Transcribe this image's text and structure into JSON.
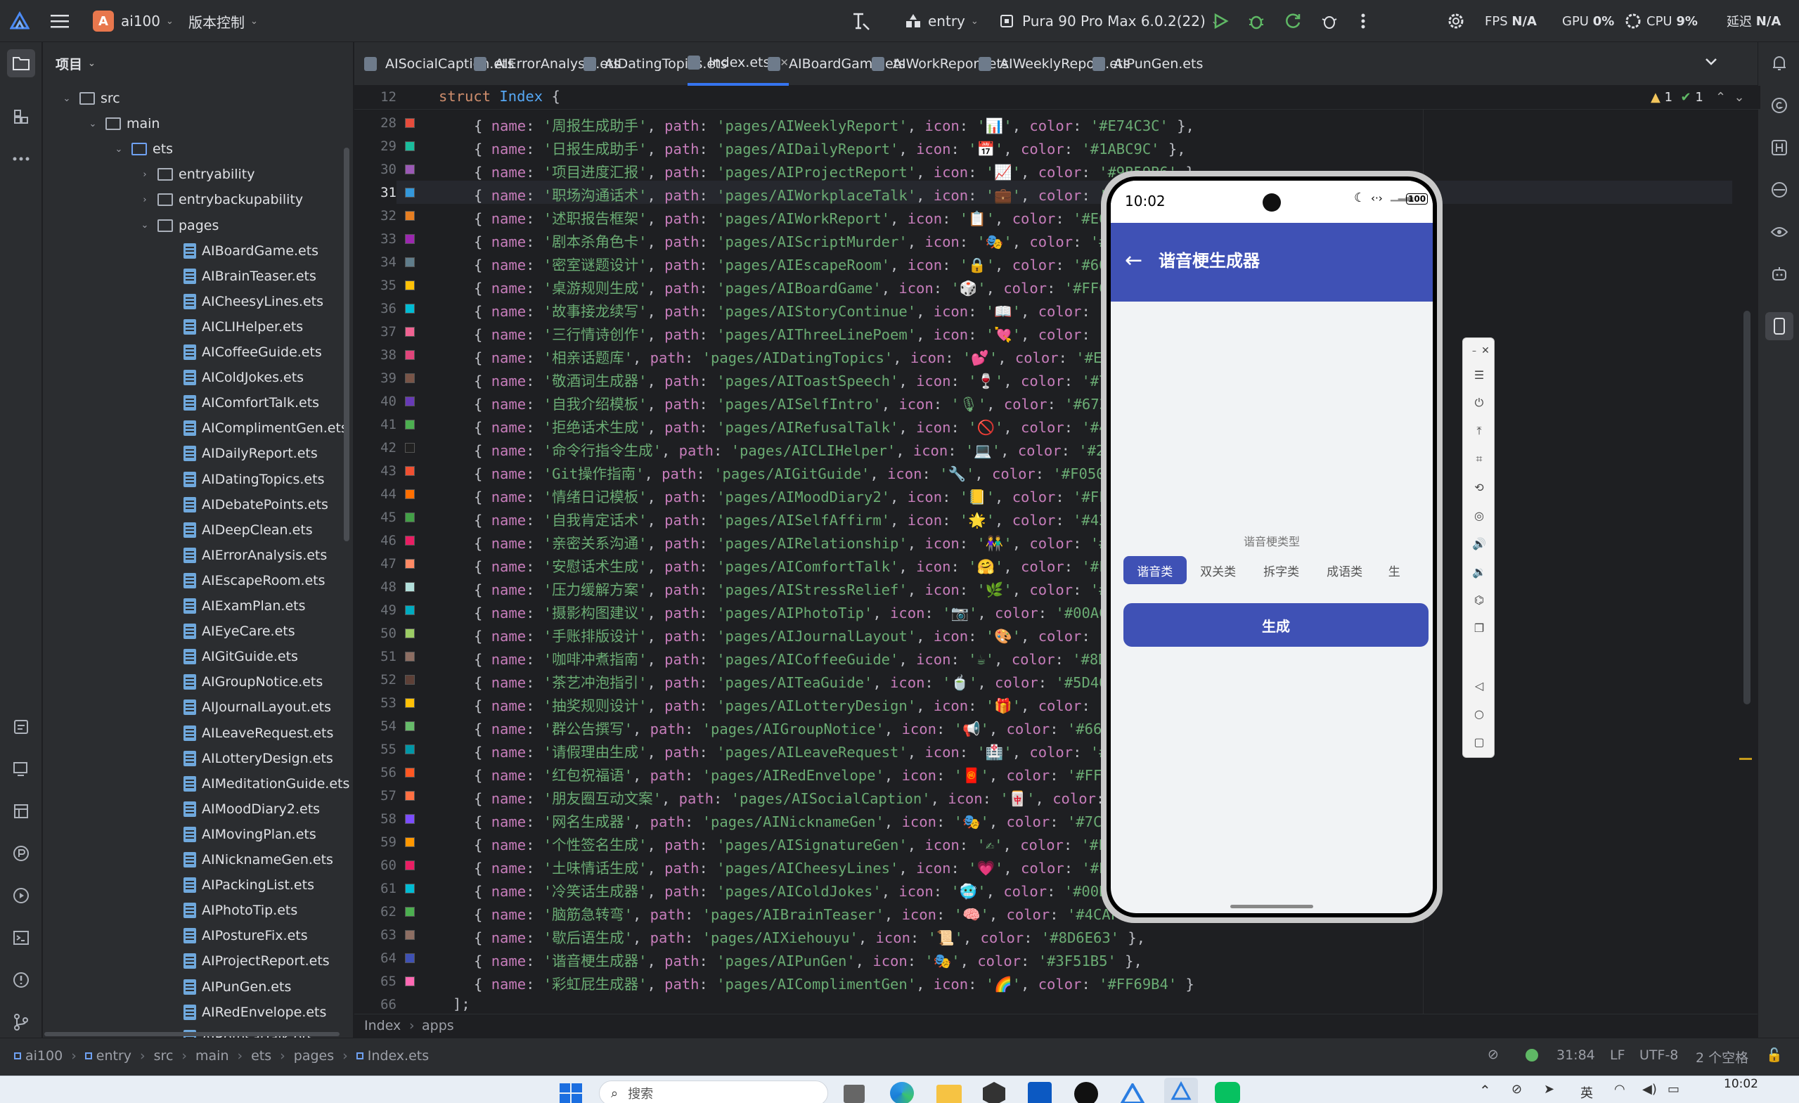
{
  "titlebar": {
    "project_badge": "A",
    "project_name": "ai100",
    "vcs_label": "版本控制",
    "run_config": "entry",
    "device": "Pura 90 Pro Max 6.0.2(22)",
    "metrics": {
      "fps_label": "FPS",
      "fps_value": "N/A",
      "gpu_label": "GPU",
      "gpu_value": "0%",
      "cpu_label": "CPU",
      "cpu_value": "9%",
      "latency_label": "延迟",
      "latency_value": "N/A"
    }
  },
  "project_panel": {
    "title": "项目",
    "tree": [
      {
        "label": "src",
        "type": "folder",
        "depth": 0,
        "expanded": true
      },
      {
        "label": "main",
        "type": "folder",
        "depth": 1,
        "expanded": true
      },
      {
        "label": "ets",
        "type": "folder-blue",
        "depth": 2,
        "expanded": true
      },
      {
        "label": "entryability",
        "type": "folder",
        "depth": 3,
        "expanded": false
      },
      {
        "label": "entrybackupability",
        "type": "folder",
        "depth": 3,
        "expanded": false
      },
      {
        "label": "pages",
        "type": "folder",
        "depth": 3,
        "expanded": true
      },
      {
        "label": "AIBoardGame.ets",
        "type": "file",
        "depth": 4
      },
      {
        "label": "AIBrainTeaser.ets",
        "type": "file",
        "depth": 4
      },
      {
        "label": "AICheesyLines.ets",
        "type": "file",
        "depth": 4
      },
      {
        "label": "AICLIHelper.ets",
        "type": "file",
        "depth": 4
      },
      {
        "label": "AICoffeeGuide.ets",
        "type": "file",
        "depth": 4
      },
      {
        "label": "AIColdJokes.ets",
        "type": "file",
        "depth": 4
      },
      {
        "label": "AIComfortTalk.ets",
        "type": "file",
        "depth": 4
      },
      {
        "label": "AIComplimentGen.ets",
        "type": "file",
        "depth": 4
      },
      {
        "label": "AIDailyReport.ets",
        "type": "file",
        "depth": 4
      },
      {
        "label": "AIDatingTopics.ets",
        "type": "file",
        "depth": 4
      },
      {
        "label": "AIDebatePoints.ets",
        "type": "file",
        "depth": 4
      },
      {
        "label": "AIDeepClean.ets",
        "type": "file",
        "depth": 4
      },
      {
        "label": "AIErrorAnalysis.ets",
        "type": "file",
        "depth": 4
      },
      {
        "label": "AIEscapeRoom.ets",
        "type": "file",
        "depth": 4
      },
      {
        "label": "AIExamPlan.ets",
        "type": "file",
        "depth": 4
      },
      {
        "label": "AIEyeCare.ets",
        "type": "file",
        "depth": 4
      },
      {
        "label": "AIGitGuide.ets",
        "type": "file",
        "depth": 4
      },
      {
        "label": "AIGroupNotice.ets",
        "type": "file",
        "depth": 4
      },
      {
        "label": "AIJournalLayout.ets",
        "type": "file",
        "depth": 4
      },
      {
        "label": "AILeaveRequest.ets",
        "type": "file",
        "depth": 4
      },
      {
        "label": "AILotteryDesign.ets",
        "type": "file",
        "depth": 4
      },
      {
        "label": "AIMeditationGuide.ets",
        "type": "file",
        "depth": 4
      },
      {
        "label": "AIMoodDiary2.ets",
        "type": "file",
        "depth": 4
      },
      {
        "label": "AIMovingPlan.ets",
        "type": "file",
        "depth": 4
      },
      {
        "label": "AINicknameGen.ets",
        "type": "file",
        "depth": 4
      },
      {
        "label": "AIPackingList.ets",
        "type": "file",
        "depth": 4
      },
      {
        "label": "AIPhotoTip.ets",
        "type": "file",
        "depth": 4
      },
      {
        "label": "AIPostureFix.ets",
        "type": "file",
        "depth": 4
      },
      {
        "label": "AIProjectReport.ets",
        "type": "file",
        "depth": 4
      },
      {
        "label": "AIPunGen.ets",
        "type": "file",
        "depth": 4
      },
      {
        "label": "AIRedEnvelope.ets",
        "type": "file",
        "depth": 4
      },
      {
        "label": "AIRefusalTalk.ets",
        "type": "file",
        "depth": 4
      }
    ]
  },
  "tabs": [
    {
      "label": "AISocialCaption.ets",
      "active": false
    },
    {
      "label": "AIErrorAnalysis.ets",
      "active": false
    },
    {
      "label": "AIDatingTopics.ets",
      "active": false
    },
    {
      "label": "Index.ets",
      "active": true
    },
    {
      "label": "AIBoardGame.ets",
      "active": false
    },
    {
      "label": "AIWorkReport.ets",
      "active": false
    },
    {
      "label": "AIWeeklyReport.ets",
      "active": false
    },
    {
      "label": "AIPunGen.ets",
      "active": false
    }
  ],
  "editor": {
    "sticky_line": {
      "num": "12",
      "text": "struct Index {"
    },
    "inspections": {
      "warnings": "1",
      "ok": "1"
    },
    "current_line": "31",
    "lines": [
      {
        "num": "28",
        "name": "周报生成助手",
        "path": "pages/AIWeeklyReport",
        "icon": "📊",
        "color": "#E74C3C",
        "tail": " },",
        "sw": "#E74C3C"
      },
      {
        "num": "29",
        "name": "日报生成助手",
        "path": "pages/AIDailyReport",
        "icon": "📅",
        "color": "#1ABC9C",
        "tail": " },",
        "sw": "#1ABC9C"
      },
      {
        "num": "30",
        "name": "项目进度汇报",
        "path": "pages/AIProjectReport",
        "icon": "📈",
        "color": "#9B59B6",
        "tail": " },",
        "sw": "#9B59B6"
      },
      {
        "num": "31",
        "name": "职场沟通话术",
        "path": "pages/AIWorkplaceTalk",
        "icon": "💼",
        "color": "#3498DB",
        "tail": " },",
        "sw": "#3498DB"
      },
      {
        "num": "32",
        "name": "述职报告框架",
        "path": "pages/AIWorkReport",
        "icon": "📋",
        "color": "#E67E22",
        "tail": " },",
        "sw": "#E67E22"
      },
      {
        "num": "33",
        "name": "剧本杀角色卡",
        "path": "pages/AIScriptMurder",
        "icon": "🎭",
        "color": "#9C27B0",
        "tail": " },",
        "sw": "#9C27B0"
      },
      {
        "num": "34",
        "name": "密室谜题设计",
        "path": "pages/AIEscapeRoom",
        "icon": "🔒",
        "color": "#607D8B",
        "tail": " },",
        "sw": "#607D8B"
      },
      {
        "num": "35",
        "name": "桌游规则生成",
        "path": "pages/AIBoardGame",
        "icon": "🎲",
        "color": "#FFC107",
        "tail": " },",
        "sw": "#FFC107"
      },
      {
        "num": "36",
        "name": "故事接龙续写",
        "path": "pages/AIStoryContinue",
        "icon": "📖",
        "color": "#00BCD4",
        "tail": " },",
        "sw": "#00BCD4"
      },
      {
        "num": "37",
        "name": "三行情诗创作",
        "path": "pages/AIThreeLinePoem",
        "icon": "💘",
        "color": "#F06292",
        "tail": " },",
        "sw": "#F06292"
      },
      {
        "num": "38",
        "name": "相亲话题库",
        "path": "pages/AIDatingTopics",
        "icon": "💕",
        "color": "#E0457B",
        "tail": " },",
        "sw": "#E0457B"
      },
      {
        "num": "39",
        "name": "敬酒词生成器",
        "path": "pages/AIToastSpeech",
        "icon": "🍷",
        "color": "#795548",
        "tail": " },",
        "sw": "#795548"
      },
      {
        "num": "40",
        "name": "自我介绍模板",
        "path": "pages/AISelfIntro",
        "icon": "🎙",
        "color": "#673AB7",
        "tail": " },",
        "sw": "#673AB7"
      },
      {
        "num": "41",
        "name": "拒绝话术生成",
        "path": "pages/AIRefusalTalk",
        "icon": "🚫",
        "color": "#4CAF50",
        "tail": " },",
        "sw": "#4CAF50"
      },
      {
        "num": "42",
        "name": "命令行指令生成",
        "path": "pages/AICLIHelper",
        "icon": "💻",
        "color": "#212121",
        "tail": " },",
        "sw": "#212121"
      },
      {
        "num": "43",
        "name": "Git操作指南",
        "path": "pages/AIGitGuide",
        "icon": "🔧",
        "color": "#F05032",
        "tail": " },",
        "sw": "#F05032"
      },
      {
        "num": "44",
        "name": "情绪日记模板",
        "path": "pages/AIMoodDiary2",
        "icon": "📒",
        "color": "#FF6F00",
        "tail": " },",
        "sw": "#FF6F00"
      },
      {
        "num": "45",
        "name": "自我肯定话术",
        "path": "pages/AISelfAffirm",
        "icon": "🌟",
        "color": "#43A047",
        "tail": " },",
        "sw": "#43A047"
      },
      {
        "num": "46",
        "name": "亲密关系沟通",
        "path": "pages/AIRelationship",
        "icon": "👫",
        "color": "#E91E63",
        "tail": " },",
        "sw": "#E91E63"
      },
      {
        "num": "47",
        "name": "安慰话术生成",
        "path": "pages/AIComfortTalk",
        "icon": "🤗",
        "color": "#FF8A65",
        "tail": " },",
        "sw": "#FF8A65"
      },
      {
        "num": "48",
        "name": "压力缓解方案",
        "path": "pages/AIStressRelief",
        "icon": "🌿",
        "color": "#B2DFDB",
        "tail": " },",
        "sw": "#B2DFDB"
      },
      {
        "num": "49",
        "name": "摄影构图建议",
        "path": "pages/AIPhotoTip",
        "icon": "📷",
        "color": "#00ACC1",
        "tail": " },",
        "sw": "#00ACC1"
      },
      {
        "num": "50",
        "name": "手账排版设计",
        "path": "pages/AIJournalLayout",
        "icon": "🎨",
        "color": "#9CCC65",
        "tail": " },",
        "sw": "#9CCC65"
      },
      {
        "num": "51",
        "name": "咖啡冲煮指南",
        "path": "pages/AICoffeeGuide",
        "icon": "☕",
        "color": "#8D6E63",
        "tail": " },",
        "sw": "#8D6E63"
      },
      {
        "num": "52",
        "name": "茶艺冲泡指引",
        "path": "pages/AITeaGuide",
        "icon": "🍵",
        "color": "#5D4037",
        "tail": " },",
        "sw": "#5D4037"
      },
      {
        "num": "53",
        "name": "抽奖规则设计",
        "path": "pages/AILotteryDesign",
        "icon": "🎁",
        "color": "#FFC107",
        "tail": " },",
        "sw": "#FFC107"
      },
      {
        "num": "54",
        "name": "群公告撰写",
        "path": "pages/AIGroupNotice",
        "icon": "📢",
        "color": "#66BB6A",
        "tail": " },",
        "sw": "#66BB6A"
      },
      {
        "num": "55",
        "name": "请假理由生成",
        "path": "pages/AILeaveRequest",
        "icon": "🏥",
        "color": "#0097A7",
        "tail": " },",
        "sw": "#0097A7"
      },
      {
        "num": "56",
        "name": "红包祝福语",
        "path": "pages/AIRedEnvelope",
        "icon": "🧧",
        "color": "#FF5722",
        "tail": " },",
        "sw": "#FF5722"
      },
      {
        "num": "57",
        "name": "朋友圈互动文案",
        "path": "pages/AISocialCaption",
        "icon": "🀄",
        "color": "#FF7043",
        "tail": " },",
        "sw": "#FF7043"
      },
      {
        "num": "58",
        "name": "网名生成器",
        "path": "pages/AINicknameGen",
        "icon": "🎭",
        "color": "#7C4DFF",
        "tail": " },",
        "sw": "#7C4DFF"
      },
      {
        "num": "59",
        "name": "个性签名生成",
        "path": "pages/AISignatureGen",
        "icon": "✍",
        "color": "#FF9800",
        "tail": " },",
        "sw": "#FF9800"
      },
      {
        "num": "60",
        "name": "土味情话生成",
        "path": "pages/AICheesyLines",
        "icon": "💗",
        "color": "#E91E63",
        "tail": " },",
        "sw": "#E91E63"
      },
      {
        "num": "61",
        "name": "冷笑话生成器",
        "path": "pages/AIColdJokes",
        "icon": "🥶",
        "color": "#00BCD4",
        "tail": " },",
        "sw": "#00BCD4"
      },
      {
        "num": "62",
        "name": "脑筋急转弯",
        "path": "pages/AIBrainTeaser",
        "icon": "🧠",
        "color": "#4CAF50",
        "tail": " },",
        "sw": "#4CAF50"
      },
      {
        "num": "63",
        "name": "歇后语生成",
        "path": "pages/AIXiehouyu",
        "icon": "📜",
        "color": "#8D6E63",
        "tail": " },",
        "sw": "#8D6E63"
      },
      {
        "num": "64",
        "name": "谐音梗生成器",
        "path": "pages/AIPunGen",
        "icon": "🎭",
        "color": "#3F51B5",
        "tail": " },",
        "sw": "#3F51B5"
      },
      {
        "num": "65",
        "name": "彩虹屁生成器",
        "path": "pages/AIComplimentGen",
        "icon": "🌈",
        "color": "#FF69B4",
        "tail": " }",
        "sw": "#FF69B4"
      }
    ],
    "closing_num": "66",
    "closing_text": "];",
    "breadcrumb": [
      "Index",
      "apps"
    ]
  },
  "phone": {
    "time": "10:02",
    "battery": "100",
    "app_title": "谐音梗生成器",
    "type_label": "谐音梗类型",
    "segments": [
      "谐音类",
      "双关类",
      "拆字类",
      "成语类",
      "生"
    ],
    "active_segment": 0,
    "button_label": "生成",
    "accent": "#3f51b5"
  },
  "statusbar": {
    "crumbs": [
      "ai100",
      "entry",
      "src",
      "main",
      "ets",
      "pages",
      "Index.ets"
    ],
    "position": "31:84",
    "line_ending": "LF",
    "encoding": "UTF-8",
    "indent": "2 个空格"
  },
  "taskbar": {
    "search_placeholder": "搜索",
    "ime": "英",
    "clock": "10:02"
  }
}
